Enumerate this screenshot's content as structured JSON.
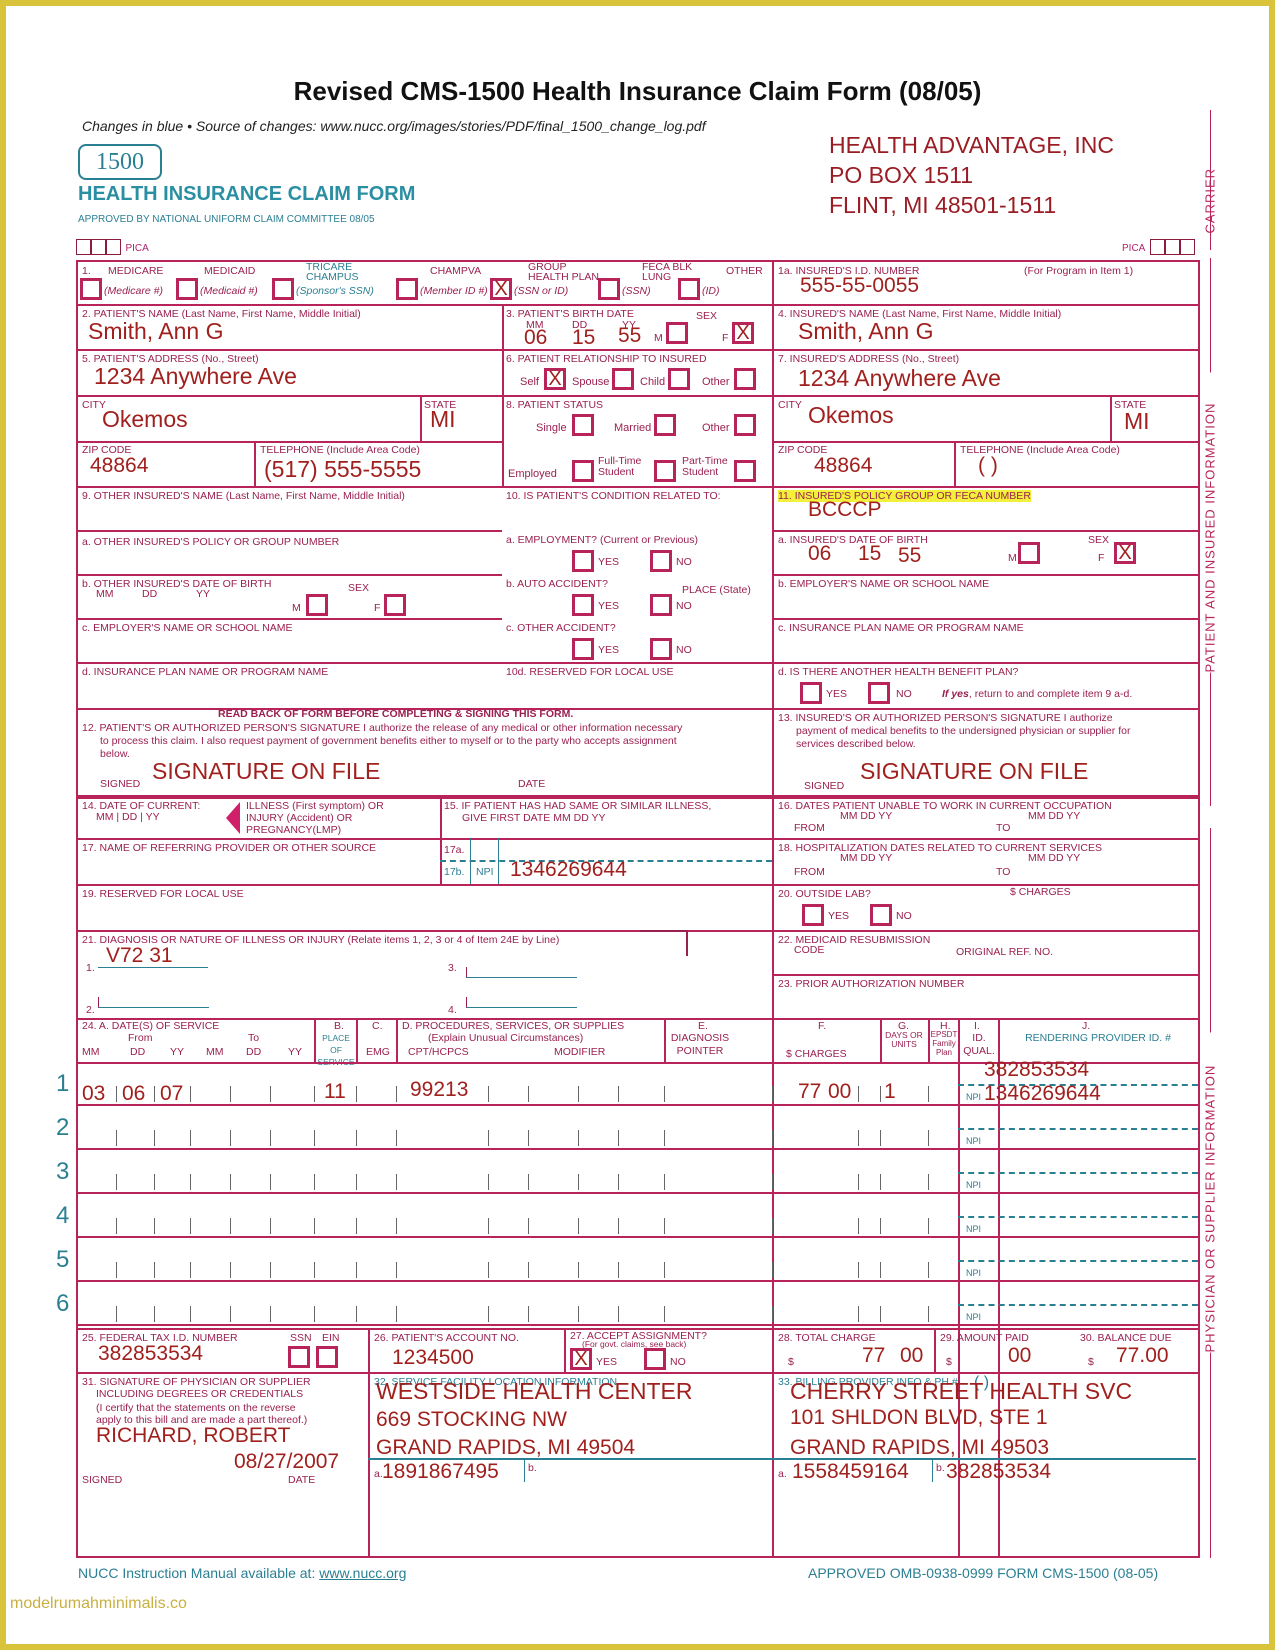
{
  "header": {
    "title": "Revised CMS-1500 Health Insurance Claim Form (08/05)",
    "subtitle": "Changes in blue  • Source of changes: www.nucc.org/images/stories/PDF/final_1500_change_log.pdf",
    "logo_number": "1500",
    "form_name": "HEALTH INSURANCE CLAIM FORM",
    "approved_by": "APPROVED BY NATIONAL UNIFORM CLAIM COMMITTEE 08/05",
    "pica_left": "PICA",
    "pica_right": "PICA",
    "carrier_lines": [
      "HEALTH ADVANTAGE, INC",
      "PO BOX 1511",
      "FLINT, MI  48501-1511"
    ]
  },
  "side_labels": {
    "carrier": "CARRIER",
    "patient": "PATIENT AND INSURED INFORMATION",
    "physician": "PHYSICIAN OR SUPPLIER INFORMATION"
  },
  "item1": {
    "label": "1.",
    "programs": [
      {
        "name": "MEDICARE",
        "sub": "(Medicare #)",
        "checked": false
      },
      {
        "name": "MEDICAID",
        "sub": "(Medicaid #)",
        "checked": false
      },
      {
        "name": "TRICARE CHAMPUS",
        "sub": "(Sponsor's SSN)",
        "checked": false
      },
      {
        "name": "CHAMPVA",
        "sub": "(Member ID #)",
        "checked": false
      },
      {
        "name": "GROUP HEALTH PLAN",
        "sub": "(SSN or ID)",
        "checked": true
      },
      {
        "name": "FECA BLK LUNG",
        "sub": "(SSN)",
        "checked": false
      },
      {
        "name": "OTHER",
        "sub": "(ID)",
        "checked": false
      }
    ],
    "mark": "X"
  },
  "item1a": {
    "label": "1a. INSURED'S I.D. NUMBER",
    "note": "(For Program in Item 1)",
    "value": "555-55-0055"
  },
  "item2": {
    "label": "2. PATIENT'S NAME (Last Name, First Name, Middle Initial)",
    "value": "Smith, Ann G"
  },
  "item3": {
    "label": "3. PATIENT'S BIRTH DATE",
    "mm_label": "MM",
    "dd_label": "DD",
    "yy_label": "YY",
    "mm": "06",
    "dd": "15",
    "yy": "55",
    "sex_label": "SEX",
    "m_label": "M",
    "f_label": "F",
    "sex": "F"
  },
  "item4": {
    "label": "4. INSURED'S NAME (Last Name, First Name, Middle Initial)",
    "value": "Smith, Ann G"
  },
  "item5": {
    "label": "5. PATIENT'S ADDRESS (No., Street)",
    "value": "1234 Anywhere Ave",
    "city_label": "CITY",
    "city": "Okemos",
    "state_label": "STATE",
    "state": "MI",
    "zip_label": "ZIP CODE",
    "zip": "48864",
    "phone_label": "TELEPHONE (Include Area Code)",
    "phone": "(517) 555-5555"
  },
  "item6": {
    "label": "6. PATIENT RELATIONSHIP TO INSURED",
    "options": [
      "Self",
      "Spouse",
      "Child",
      "Other"
    ],
    "selected": "Self"
  },
  "item7": {
    "label": "7. INSURED'S ADDRESS (No., Street)",
    "value": "1234 Anywhere Ave",
    "city_label": "CITY",
    "city": "Okemos",
    "state_label": "STATE",
    "state": "MI",
    "zip_label": "ZIP CODE",
    "zip": "48864",
    "phone_label": "TELEPHONE (Include Area Code)",
    "phone": "(        )"
  },
  "item8": {
    "label": "8. PATIENT STATUS",
    "row1": [
      "Single",
      "Married",
      "Other"
    ],
    "row2": [
      "Employed",
      "Full-Time Student",
      "Part-Time Student"
    ]
  },
  "item9": {
    "label": "9. OTHER INSURED'S NAME (Last Name, First Name, Middle Initial)",
    "a": "a. OTHER INSURED'S POLICY OR GROUP NUMBER",
    "b": "b. OTHER INSURED'S DATE OF BIRTH",
    "b_sex": "SEX",
    "c": "c. EMPLOYER'S NAME OR SCHOOL NAME",
    "d": "d. INSURANCE PLAN NAME OR PROGRAM NAME",
    "mm": "MM",
    "dd": "DD",
    "yy": "YY",
    "m": "M",
    "f": "F"
  },
  "item10": {
    "label": "10. IS PATIENT'S CONDITION RELATED TO:",
    "a": "a. EMPLOYMENT? (Current or Previous)",
    "b": "b. AUTO ACCIDENT?",
    "place": "PLACE (State)",
    "c": "c. OTHER ACCIDENT?",
    "d": "10d. RESERVED FOR LOCAL USE",
    "yes": "YES",
    "no": "NO"
  },
  "item11": {
    "label": "11. INSURED'S POLICY GROUP OR FECA NUMBER",
    "value": "BCCCP",
    "a": "a. INSURED'S DATE OF BIRTH",
    "mm": "06",
    "dd": "15",
    "yy": "55",
    "sex_label": "SEX",
    "sex": "F",
    "b": "b. EMPLOYER'S NAME OR SCHOOL NAME",
    "c": "c. INSURANCE PLAN NAME OR PROGRAM NAME",
    "d": "d. IS THERE ANOTHER HEALTH BENEFIT PLAN?",
    "d_note_bold": "If yes",
    "d_note": ", return to and complete item 9 a-d.",
    "yes": "YES",
    "no": "NO"
  },
  "item12": {
    "heading": "READ BACK OF FORM BEFORE COMPLETING & SIGNING THIS FORM.",
    "label": "12. PATIENT'S OR AUTHORIZED PERSON'S SIGNATURE  I authorize the release of any medical or other information necessary",
    "line2": "to process this claim. I also request payment of government benefits either to myself or to the party who accepts assignment",
    "line3": "below.",
    "signed_label": "SIGNED",
    "signed": "SIGNATURE ON FILE",
    "date_label": "DATE"
  },
  "item13": {
    "label": "13. INSURED'S OR AUTHORIZED PERSON'S SIGNATURE I authorize",
    "line2": "payment of medical benefits to the undersigned physician or supplier for",
    "line3": "services described below.",
    "signed_label": "SIGNED",
    "signed": "SIGNATURE ON FILE"
  },
  "item14": {
    "label": "14. DATE OF CURRENT:",
    "sub": "MM  |  DD  |    YY",
    "desc1": "ILLNESS (First symptom) OR",
    "desc2": "INJURY (Accident) OR",
    "desc3": "PREGNANCY(LMP)"
  },
  "item15": {
    "label": "15. IF PATIENT HAS HAD SAME OR SIMILAR ILLNESS,",
    "sub": "GIVE FIRST DATE   MM        DD          YY"
  },
  "item16": {
    "label": "16. DATES PATIENT UNABLE TO WORK IN CURRENT OCCUPATION",
    "from": "FROM",
    "to": "TO",
    "cols": "MM    DD       YY"
  },
  "item17": {
    "label": "17. NAME OF REFERRING PROVIDER OR OTHER SOURCE",
    "a": "17a.",
    "b": "17b.",
    "npi": "NPI",
    "npi_value": "1346269644"
  },
  "item18": {
    "label": "18. HOSPITALIZATION DATES RELATED TO CURRENT SERVICES",
    "from": "FROM",
    "to": "TO",
    "cols": "MM    DD       YY"
  },
  "item19": {
    "label": "19. RESERVED FOR LOCAL USE"
  },
  "item20": {
    "label": "20. OUTSIDE LAB?",
    "charges": "$ CHARGES",
    "yes": "YES",
    "no": "NO"
  },
  "item21": {
    "label": "21. DIAGNOSIS OR NATURE OF ILLNESS OR INJURY (Relate items 1, 2, 3 or 4 of Item 24E by Line)",
    "d1_label": "1.",
    "d1": "V72 31",
    "d2_label": "2.",
    "d3_label": "3.",
    "d4_label": "4."
  },
  "item22": {
    "label": "22. MEDICAID RESUBMISSION",
    "code": "CODE",
    "ref": "ORIGINAL REF. NO."
  },
  "item23": {
    "label": "23. PRIOR AUTHORIZATION NUMBER"
  },
  "item24": {
    "headers": {
      "a": "24.  A.          DATE(S) OF SERVICE",
      "from": "From",
      "to": "To",
      "cols": [
        "MM",
        "DD",
        "YY",
        "MM",
        "DD",
        "YY"
      ],
      "b": "B.",
      "b_sub": "PLACE OF SERVICE",
      "c": "C.",
      "c_sub": "EMG",
      "d": "D. PROCEDURES, SERVICES, OR SUPPLIES",
      "d_sub": "(Explain Unusual Circumstances)",
      "cpt": "CPT/HCPCS",
      "modifier": "MODIFIER",
      "e": "E.",
      "e_sub": "DIAGNOSIS POINTER",
      "f": "F.",
      "f_sub": "$ CHARGES",
      "g": "G.",
      "g_sub": "DAYS OR UNITS",
      "h": "H.",
      "h_sub": "EPSDT Family Plan",
      "i": "I.",
      "i_sub": "ID. QUAL.",
      "j": "J.",
      "j_sub": "RENDERING PROVIDER ID. #"
    },
    "npi": "NPI",
    "rows": [
      {
        "n": "1",
        "from_mm": "03",
        "from_dd": "06",
        "from_yy": "07",
        "pos": "11",
        "cpt": "99213",
        "charges": "77",
        "cents": "00",
        "units": "1",
        "provider_id": "382853534",
        "npi_value": "1346269644"
      },
      {
        "n": "2"
      },
      {
        "n": "3"
      },
      {
        "n": "4"
      },
      {
        "n": "5"
      },
      {
        "n": "6"
      }
    ]
  },
  "item25": {
    "label": "25. FEDERAL TAX I.D. NUMBER",
    "ssn": "SSN",
    "ein": "EIN",
    "value": "382853534"
  },
  "item26": {
    "label": "26. PATIENT'S ACCOUNT NO.",
    "value": "1234500"
  },
  "item27": {
    "label": "27. ACCEPT ASSIGNMENT?",
    "sub": "(For govt. claims, see back)",
    "yes": "YES",
    "no": "NO",
    "selected": "YES"
  },
  "item28": {
    "label": "28. TOTAL CHARGE",
    "dollar": "$",
    "value": "77",
    "cents": "00"
  },
  "item29": {
    "label": "29. AMOUNT PAID",
    "dollar": "$",
    "cents": "00"
  },
  "item30": {
    "label": "30. BALANCE DUE",
    "dollar": "$",
    "value": "77.00"
  },
  "item31": {
    "label": "31. SIGNATURE OF PHYSICIAN OR SUPPLIER",
    "l2": "INCLUDING DEGREES OR CREDENTIALS",
    "l3": "(I certify that the statements on the reverse",
    "l4": "apply to this bill and are made a part thereof.)",
    "name": "RICHARD, ROBERT",
    "date": "08/27/2007",
    "signed": "SIGNED",
    "date_label": "DATE"
  },
  "item32": {
    "label": "32. SERVICE FACILITY LOCATION INFORMATION",
    "lines": [
      "WESTSIDE HEALTH CENTER",
      "669 STOCKING NW",
      "GRAND RAPIDS, MI  49504"
    ],
    "a_label": "a.",
    "a": "1891867495",
    "b_label": "b."
  },
  "item33": {
    "label": "33. BILLING PROVIDER INFO & PH #",
    "phone": "(        )",
    "lines": [
      "CHERRY STREET HEALTH SVC",
      "101 SHLDON BLVD, STE 1",
      "GRAND RAPIDS, MI  49503"
    ],
    "a_label": "a.",
    "a": "1558459164",
    "b_label": "b.",
    "b": "382853534"
  },
  "footer": {
    "left": "NUCC Instruction Manual available at: ",
    "link": "www.nucc.org",
    "right": "APPROVED OMB-0938-0999 FORM CMS-1500 (08-05)"
  },
  "watermark": "modelrumahminimalis.co"
}
